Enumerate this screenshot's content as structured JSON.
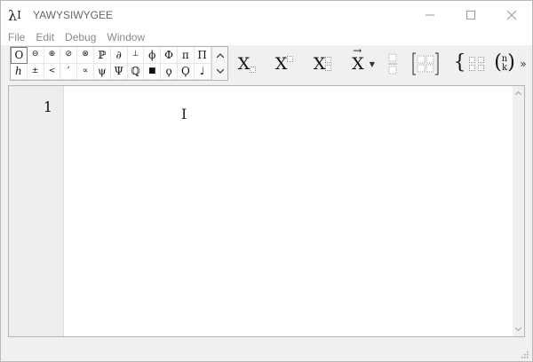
{
  "window": {
    "title": "YAWYSIWYGEE",
    "app_icon": {
      "main": "λ",
      "sub": "I"
    },
    "controls": {
      "minimize_icon": "minimize-icon",
      "maximize_icon": "maximize-icon",
      "close_icon": "close-icon"
    }
  },
  "menu": {
    "items": [
      "File",
      "Edit",
      "Debug",
      "Window"
    ]
  },
  "symbol_palette": {
    "rows": [
      [
        "O",
        "⊖",
        "⊕",
        "⊘",
        "⊗",
        "ℙ",
        "∂",
        "⊥",
        "ϕ",
        "Φ",
        "π",
        "Π"
      ],
      [
        "ℎ",
        "±",
        "<",
        "′",
        "∝",
        "ψ",
        "Ψ",
        "ℚ",
        "■",
        "ϙ",
        "Ϙ",
        "♩"
      ]
    ],
    "scroll_up_icon": "chevron-up-icon",
    "scroll_down_icon": "chevron-down-icon"
  },
  "toolbar": {
    "subscript_label": "X",
    "superscript_label": "X",
    "subsuperscript_label": "X",
    "accent_label": "X",
    "accent_arrow": "→",
    "accent_dropdown": "▼",
    "fraction_icon": "fraction-icon",
    "matrix_icon": "matrix-icon",
    "cases_label": "{",
    "binomial_top": "n",
    "binomial_bottom": "k",
    "more_label": "»"
  },
  "editor": {
    "line_numbers": [
      "1"
    ],
    "content": "",
    "cursor_glyph": "I"
  },
  "colors": {
    "chrome": "#f0f0f0",
    "gutter": "#eeeeee",
    "border": "#b4b4b4"
  }
}
